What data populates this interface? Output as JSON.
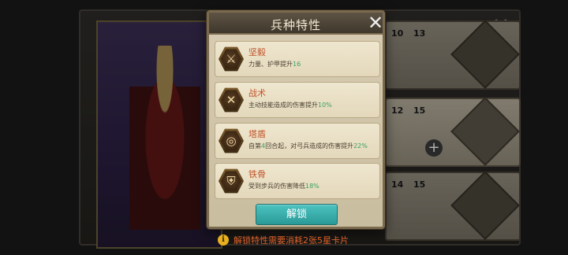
{
  "modal": {
    "title": "兵种特性",
    "close_icon": "close-icon",
    "unlock_label": "解锁"
  },
  "traits": [
    {
      "name": "坚毅",
      "icon": "sword-upright-icon",
      "glyph": "⚔",
      "desc_pre": "力量、护甲提升",
      "value": "16",
      "desc_post": ""
    },
    {
      "name": "战术",
      "icon": "crossed-swords-icon",
      "glyph": "✕",
      "desc_pre": "主动技能造成的伤害提升",
      "value": "10%",
      "desc_post": ""
    },
    {
      "name": "塔盾",
      "icon": "spiral-shield-icon",
      "glyph": "◎",
      "desc_pre": "自第",
      "value": "4",
      "desc_mid": "回合起，对弓兵造成的伤害提升",
      "value2": "22%",
      "desc_post": ""
    },
    {
      "name": "铁骨",
      "icon": "armor-icon",
      "glyph": "⛨",
      "desc_pre": "受到步兵的伤害降低",
      "value": "18%",
      "desc_post": ""
    }
  ],
  "footer": {
    "note": "解锁特性需要消耗2张5星卡片",
    "info_icon": "info-icon"
  },
  "background": {
    "cards": [
      {
        "stat_a": "10",
        "stat_b": "13"
      },
      {
        "stat_a": "12",
        "stat_b": "15"
      },
      {
        "stat_a": "14",
        "stat_b": "15"
      }
    ],
    "plus_label": "+"
  },
  "colors": {
    "trait_name": "#c0542a",
    "highlight": "#3aa060",
    "unlock_button": "#2a9a98",
    "note": "#e0612a"
  }
}
